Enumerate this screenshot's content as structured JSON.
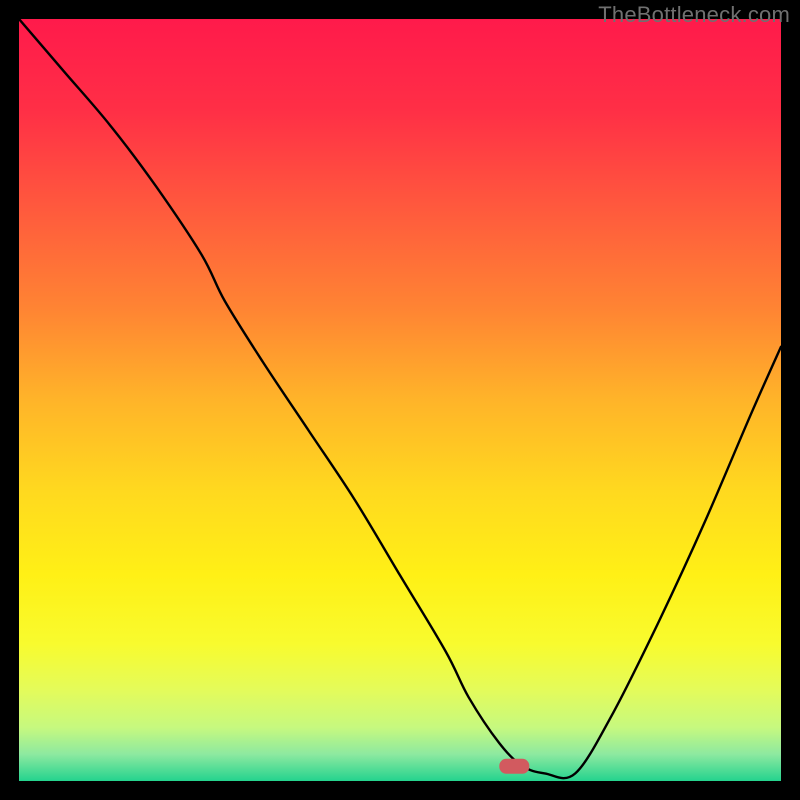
{
  "watermark": "TheBottleneck.com",
  "chart_data": {
    "type": "line",
    "title": "",
    "xlabel": "",
    "ylabel": "",
    "xlim": [
      0,
      100
    ],
    "ylim": [
      0,
      100
    ],
    "series": [
      {
        "name": "bottleneck-curve",
        "x": [
          0,
          6,
          12,
          18,
          24,
          27,
          32,
          38,
          44,
          50,
          56,
          59,
          63,
          66,
          69,
          73,
          78,
          84,
          90,
          96,
          100
        ],
        "y": [
          100,
          93,
          86,
          78,
          69,
          63,
          55,
          46,
          37,
          27,
          17,
          11,
          5,
          2,
          1,
          1,
          9,
          21,
          34,
          48,
          57
        ]
      }
    ],
    "marker": {
      "x": 65,
      "y": 2
    },
    "gradient_stops": [
      {
        "offset": 0.0,
        "color": "#ff1a4b"
      },
      {
        "offset": 0.12,
        "color": "#ff2f46"
      },
      {
        "offset": 0.25,
        "color": "#ff5a3d"
      },
      {
        "offset": 0.38,
        "color": "#ff8433"
      },
      {
        "offset": 0.5,
        "color": "#ffb429"
      },
      {
        "offset": 0.62,
        "color": "#ffd91f"
      },
      {
        "offset": 0.73,
        "color": "#fff016"
      },
      {
        "offset": 0.82,
        "color": "#f8fb2e"
      },
      {
        "offset": 0.88,
        "color": "#e4fb5a"
      },
      {
        "offset": 0.93,
        "color": "#c6f97f"
      },
      {
        "offset": 0.965,
        "color": "#8de9a0"
      },
      {
        "offset": 1.0,
        "color": "#24d38e"
      }
    ]
  }
}
